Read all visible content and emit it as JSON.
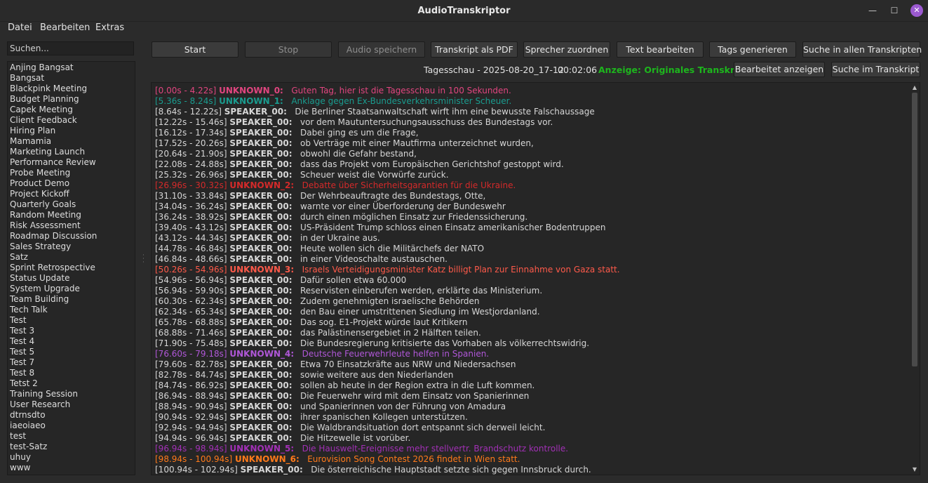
{
  "window": {
    "title": "AudioTranskriptor",
    "minimize_glyph": "—",
    "maximize_glyph": "☐",
    "close_glyph": "✕"
  },
  "menu": [
    "Datei",
    "Bearbeiten",
    "Extras"
  ],
  "search": {
    "placeholder": "Suchen..."
  },
  "sessions": [
    "Anjing Bangsat",
    "Bangsat",
    "Blackpink Meeting",
    "Budget Planning",
    "Capek Meeting",
    "Client Feedback",
    "Hiring Plan",
    "Mamamia",
    "Marketing Launch",
    "Performance Review",
    "Probe Meeting",
    "Product Demo",
    "Project Kickoff",
    "Quarterly Goals",
    "Random Meeting",
    "Risk Assessment",
    "Roadmap Discussion",
    "Sales Strategy",
    "Satz",
    "Sprint Retrospective",
    "Status Update",
    "System Upgrade",
    "Team Building",
    "Tech Talk",
    "Test",
    "Test 3",
    "Test 4",
    "Test 5",
    "Test 7",
    "Test 8",
    "Tetst 2",
    "Training Session",
    "User Research",
    "dtrnsdto",
    "iaeoiaeo",
    "test",
    "test-Satz",
    "uhuy",
    "www"
  ],
  "toolbar": {
    "start": "Start",
    "stop": "Stop",
    "save_audio": "Audio speichern",
    "export_pdf": "Transkript als PDF",
    "assign_speaker": "Sprecher zuordnen",
    "edit_text": "Text bearbeiten",
    "generate_tags": "Tags generieren",
    "search_all": "Suche in allen Transkripten"
  },
  "info_bar": {
    "file_name": "Tagesschau - 2025-08-20_17-12",
    "duration": "00:02:06",
    "mode_label": "Anzeige: Originales Transkript",
    "show_edited": "Bearbeitet anzeigen",
    "search_in_transcript": "Suche im Transkript"
  },
  "colors": {
    "mode_label": "#1db61d",
    "close_button": "#9b59d0",
    "speaker_default": "#d6d6d6",
    "unknown_0": "#e0457f",
    "unknown_1": "#1a9c8f",
    "unknown_2": "#d42a2a",
    "unknown_3": "#ff5a4a",
    "unknown_4": "#b057d8",
    "unknown_5": "#a230b6",
    "unknown_6": "#ff7a1a"
  },
  "transcript": [
    {
      "time": "[0.00s - 4.22s]",
      "speaker": "UNKNOWN_0:",
      "text": "Guten Tag, hier ist die Tagesschau in 100 Sekunden.",
      "color": "#e0457f"
    },
    {
      "time": "[5.36s - 8.24s]",
      "speaker": "UNKNOWN_1:",
      "text": "Anklage gegen Ex-Bundesverkehrsminister Scheuer.",
      "color": "#1a9c8f"
    },
    {
      "time": "[8.64s - 12.22s]",
      "speaker": "SPEAKER_00:",
      "text": "Die Berliner Staatsanwaltschaft wirft ihm eine bewusste Falschaussage",
      "color": "#d6d6d6"
    },
    {
      "time": "[12.22s - 15.46s]",
      "speaker": "SPEAKER_00:",
      "text": "vor dem Mautuntersuchungsausschuss des Bundestags vor.",
      "color": "#d6d6d6"
    },
    {
      "time": "[16.12s - 17.34s]",
      "speaker": "SPEAKER_00:",
      "text": "Dabei ging es um die Frage,",
      "color": "#d6d6d6"
    },
    {
      "time": "[17.52s - 20.26s]",
      "speaker": "SPEAKER_00:",
      "text": "ob Verträge mit einer Mautfirma unterzeichnet wurden,",
      "color": "#d6d6d6"
    },
    {
      "time": "[20.64s - 21.90s]",
      "speaker": "SPEAKER_00:",
      "text": "obwohl die Gefahr bestand,",
      "color": "#d6d6d6"
    },
    {
      "time": "[22.08s - 24.88s]",
      "speaker": "SPEAKER_00:",
      "text": "dass das Projekt vom Europäischen Gerichtshof gestoppt wird.",
      "color": "#d6d6d6"
    },
    {
      "time": "[25.32s - 26.96s]",
      "speaker": "SPEAKER_00:",
      "text": "Scheuer weist die Vorwürfe zurück.",
      "color": "#d6d6d6"
    },
    {
      "time": "[26.96s - 30.32s]",
      "speaker": "UNKNOWN_2:",
      "text": "Debatte über Sicherheitsgarantien für die Ukraine.",
      "color": "#d42a2a"
    },
    {
      "time": "[31.10s - 33.84s]",
      "speaker": "SPEAKER_00:",
      "text": "Der Wehrbeauftragte des Bundestags, Otte,",
      "color": "#d6d6d6"
    },
    {
      "time": "[34.04s - 36.24s]",
      "speaker": "SPEAKER_00:",
      "text": "warnte vor einer Überforderung der Bundeswehr",
      "color": "#d6d6d6"
    },
    {
      "time": "[36.24s - 38.92s]",
      "speaker": "SPEAKER_00:",
      "text": "durch einen möglichen Einsatz zur Friedenssicherung.",
      "color": "#d6d6d6"
    },
    {
      "time": "[39.40s - 43.12s]",
      "speaker": "SPEAKER_00:",
      "text": "US-Präsident Trump schloss einen Einsatz amerikanischer Bodentruppen",
      "color": "#d6d6d6"
    },
    {
      "time": "[43.12s - 44.34s]",
      "speaker": "SPEAKER_00:",
      "text": "in der Ukraine aus.",
      "color": "#d6d6d6"
    },
    {
      "time": "[44.78s - 46.84s]",
      "speaker": "SPEAKER_00:",
      "text": "Heute wollen sich die Militärchefs der NATO",
      "color": "#d6d6d6"
    },
    {
      "time": "[46.84s - 48.66s]",
      "speaker": "SPEAKER_00:",
      "text": "in einer Videoschalte austauschen.",
      "color": "#d6d6d6"
    },
    {
      "time": "[50.26s - 54.96s]",
      "speaker": "UNKNOWN_3:",
      "text": "Israels Verteidigungsminister Katz billigt Plan zur Einnahme von Gaza statt.",
      "color": "#ff5a4a"
    },
    {
      "time": "[54.96s - 56.94s]",
      "speaker": "SPEAKER_00:",
      "text": "Dafür sollen etwa 60.000",
      "color": "#d6d6d6"
    },
    {
      "time": "[56.94s - 59.90s]",
      "speaker": "SPEAKER_00:",
      "text": "Reservisten einberufen werden, erklärte das Ministerium.",
      "color": "#d6d6d6"
    },
    {
      "time": "[60.30s - 62.34s]",
      "speaker": "SPEAKER_00:",
      "text": "Zudem genehmigten israelische Behörden",
      "color": "#d6d6d6"
    },
    {
      "time": "[62.34s - 65.34s]",
      "speaker": "SPEAKER_00:",
      "text": "den Bau einer umstrittenen Siedlung im Westjordanland.",
      "color": "#d6d6d6"
    },
    {
      "time": "[65.78s - 68.88s]",
      "speaker": "SPEAKER_00:",
      "text": "Das sog. E1-Projekt würde laut Kritikern",
      "color": "#d6d6d6"
    },
    {
      "time": "[68.88s - 71.46s]",
      "speaker": "SPEAKER_00:",
      "text": "das Palästinensergebiet in 2 Hälften teilen.",
      "color": "#d6d6d6"
    },
    {
      "time": "[71.90s - 75.48s]",
      "speaker": "SPEAKER_00:",
      "text": "Die Bundesregierung kritisierte das Vorhaben als völkerrechtswidrig.",
      "color": "#d6d6d6"
    },
    {
      "time": "[76.60s - 79.18s]",
      "speaker": "UNKNOWN_4:",
      "text": "Deutsche Feuerwehrleute helfen in Spanien.",
      "color": "#b057d8"
    },
    {
      "time": "[79.60s - 82.78s]",
      "speaker": "SPEAKER_00:",
      "text": "Etwa 70 Einsatzkräfte aus NRW und Niedersachsen",
      "color": "#d6d6d6"
    },
    {
      "time": "[82.78s - 84.74s]",
      "speaker": "SPEAKER_00:",
      "text": "sowie weitere aus den Niederlanden",
      "color": "#d6d6d6"
    },
    {
      "time": "[84.74s - 86.92s]",
      "speaker": "SPEAKER_00:",
      "text": "sollen ab heute in der Region extra in die Luft kommen.",
      "color": "#d6d6d6"
    },
    {
      "time": "[86.94s - 88.94s]",
      "speaker": "SPEAKER_00:",
      "text": "Die Feuerwehr wird mit dem Einsatz von Spanierinnen",
      "color": "#d6d6d6"
    },
    {
      "time": "[88.94s - 90.94s]",
      "speaker": "SPEAKER_00:",
      "text": "und Spanierinnen von der Führung von Amadura",
      "color": "#d6d6d6"
    },
    {
      "time": "[90.94s - 92.94s]",
      "speaker": "SPEAKER_00:",
      "text": "ihrer spanischen Kollegen unterstützen.",
      "color": "#d6d6d6"
    },
    {
      "time": "[92.94s - 94.94s]",
      "speaker": "SPEAKER_00:",
      "text": "Die Waldbrandsituation dort entspannt sich derweil leicht.",
      "color": "#d6d6d6"
    },
    {
      "time": "[94.94s - 96.94s]",
      "speaker": "SPEAKER_00:",
      "text": "Die Hitzewelle ist vorüber.",
      "color": "#d6d6d6"
    },
    {
      "time": "[96.94s - 98.94s]",
      "speaker": "UNKNOWN_5:",
      "text": "Die Hauswelt-Ereignisse mehr stellvertr. Brandschutz kontrolle.",
      "color": "#a230b6"
    },
    {
      "time": "[98.94s - 100.94s]",
      "speaker": "UNKNOWN_6:",
      "text": "Eurovision Song Contest 2026 findet in Wien statt.",
      "color": "#ff7a1a"
    },
    {
      "time": "[100.94s - 102.94s]",
      "speaker": "SPEAKER_00:",
      "text": "Die österreichische Hauptstadt setzte sich gegen Innsbruck durch.",
      "color": "#d6d6d6"
    }
  ]
}
